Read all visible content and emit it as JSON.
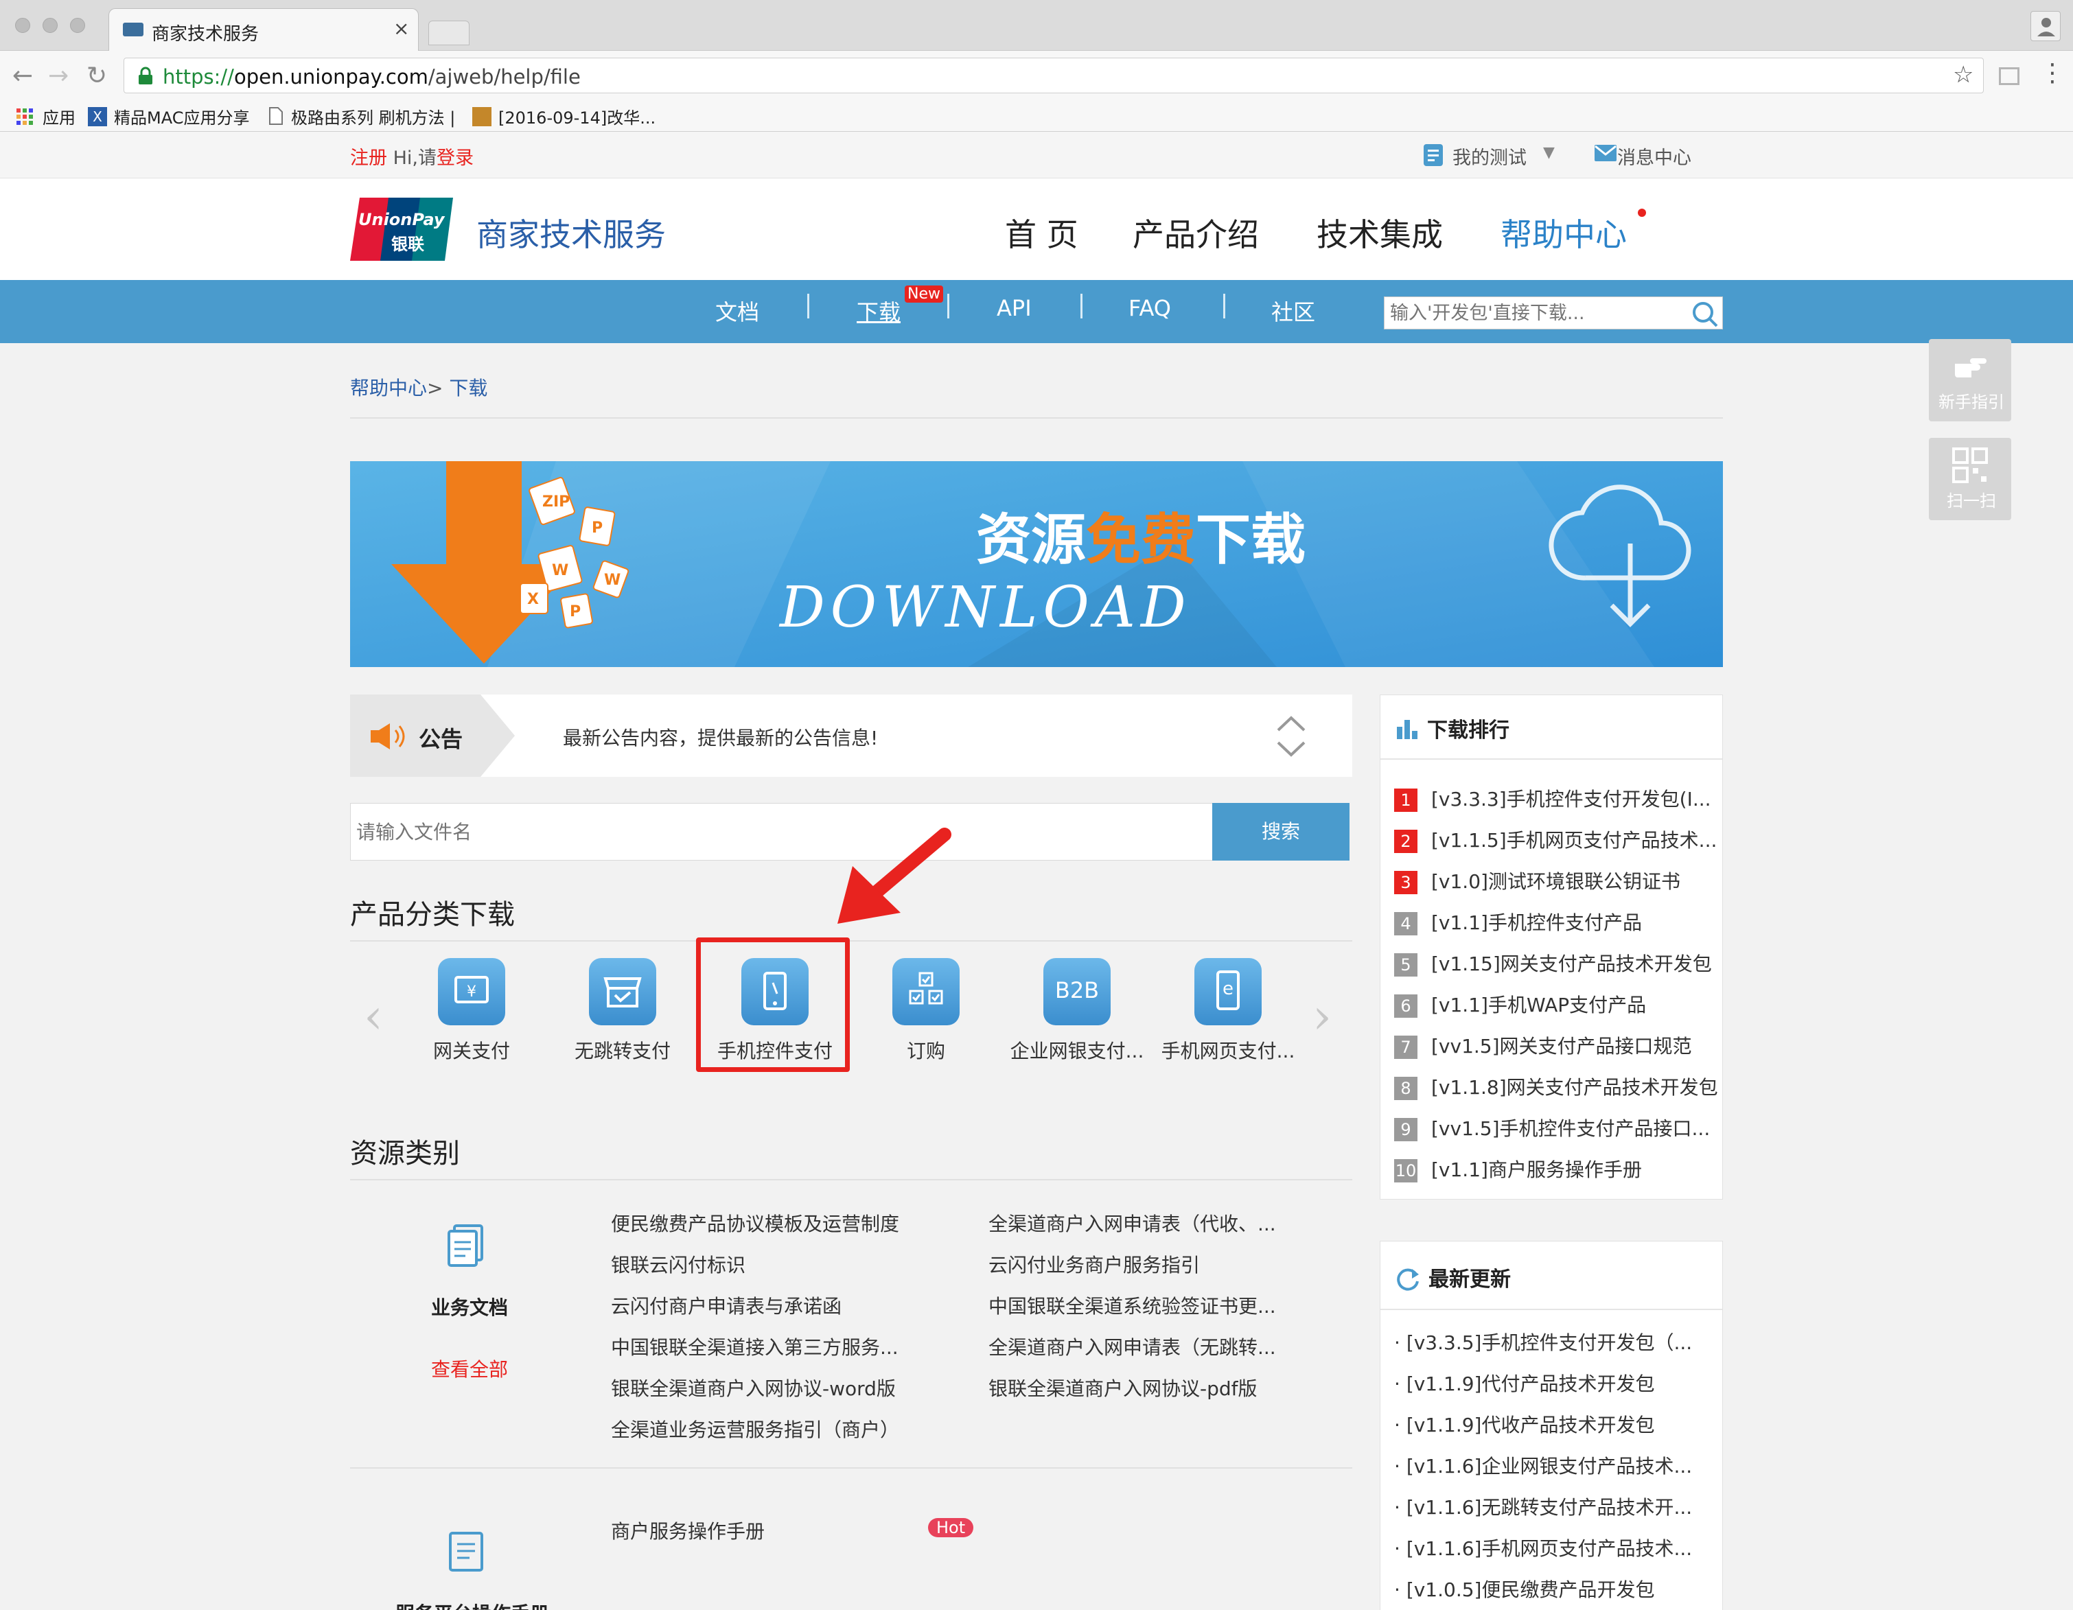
{
  "browser": {
    "tab_title": "商家技术服务",
    "url_secure": "https://",
    "url_host": "open.unionpay.com",
    "url_path": "/ajweb/help/file",
    "bookmarks": [
      "应用",
      "精品MAC应用分享",
      "极路由系列 刷机方法 |",
      "[2016-09-14]改华..."
    ]
  },
  "topbar": {
    "register": "注册",
    "greeting": "Hi,请",
    "login": "登录",
    "my_test": "我的测试",
    "messages": "消息中心"
  },
  "header": {
    "logo_text_en": "UnionPay",
    "logo_text_cn": "银联",
    "site_title": "商家技术服务",
    "nav": [
      "首 页",
      "产品介绍",
      "技术集成",
      "帮助中心"
    ]
  },
  "subnav": {
    "items": [
      "文档",
      "下载",
      "API",
      "FAQ",
      "社区"
    ],
    "new_badge": "New",
    "search_placeholder": "输入'开发包'直接下载..."
  },
  "float_buttons": [
    "新手指引",
    "扫一扫"
  ],
  "breadcrumb": {
    "root": "帮助中心",
    "sep": ">",
    "current": "下载"
  },
  "banner": {
    "title_a": "资源",
    "title_b": "免费",
    "title_c": "下载",
    "subtitle": "DOWNLOAD",
    "file_tags": [
      "ZIP",
      "P",
      "W",
      "W",
      "X",
      "P"
    ]
  },
  "notice": {
    "label": "公告",
    "text": "最新公告内容，提供最新的公告信息!"
  },
  "file_search": {
    "placeholder": "请输入文件名",
    "button": "搜索"
  },
  "products": {
    "title": "产品分类下载",
    "items": [
      {
        "label": "网关支付",
        "icon": "gateway-pay-icon"
      },
      {
        "label": "无跳转支付",
        "icon": "store-pay-icon"
      },
      {
        "label": "手机控件支付",
        "icon": "mobile-control-icon"
      },
      {
        "label": "订购",
        "icon": "order-icon"
      },
      {
        "label": "企业网银支付...",
        "icon": "b2b-icon",
        "icon_text": "B2B"
      },
      {
        "label": "手机网页支付...",
        "icon": "mobile-web-icon",
        "icon_text": "e"
      }
    ],
    "highlight_color": "#e8231f"
  },
  "resources": {
    "title": "资源类别",
    "group1": {
      "name": "业务文档",
      "view_all": "查看全部",
      "col1": [
        "便民缴费产品协议模板及运营制度",
        "银联云闪付标识",
        "云闪付商户申请表与承诺函",
        "中国银联全渠道接入第三方服务...",
        "银联全渠道商户入网协议-word版",
        "全渠道业务运营服务指引（商户）"
      ],
      "col2": [
        "全渠道商户入网申请表（代收、...",
        "云闪付业务商户服务指引",
        "中国银联全渠道系统验签证书更...",
        "全渠道商户入网申请表（无跳转...",
        "银联全渠道商户入网协议-pdf版"
      ]
    },
    "group2": {
      "name": "服务平台操作手册",
      "item": "商户服务操作手册",
      "badge": "Hot"
    }
  },
  "ranking": {
    "title": "下载排行",
    "items": [
      {
        "num": "1",
        "text": "[v3.3.3]手机控件支付开发包(I..."
      },
      {
        "num": "2",
        "text": "[v1.1.5]手机网页支付产品技术..."
      },
      {
        "num": "3",
        "text": "[v1.0]测试环境银联公钥证书"
      },
      {
        "num": "4",
        "text": "[v1.1]手机控件支付产品"
      },
      {
        "num": "5",
        "text": "[v1.15]网关支付产品技术开发包"
      },
      {
        "num": "6",
        "text": "[v1.1]手机WAP支付产品"
      },
      {
        "num": "7",
        "text": "[vv1.5]网关支付产品接口规范"
      },
      {
        "num": "8",
        "text": "[v1.1.8]网关支付产品技术开发包"
      },
      {
        "num": "9",
        "text": "[vv1.5]手机控件支付产品接口..."
      },
      {
        "num": "10",
        "text": "[v1.1]商户服务操作手册"
      }
    ],
    "colors": {
      "top": "#e8231f",
      "rest": "#9a9a9a"
    }
  },
  "updates": {
    "title": "最新更新",
    "items": [
      "[v3.3.5]手机控件支付开发包（...",
      "[v1.1.9]代付产品技术开发包",
      "[v1.1.9]代收产品技术开发包",
      "[v1.1.6]企业网银支付产品技术...",
      "[v1.1.6]无跳转支付产品技术开...",
      "[v1.1.6]手机网页支付产品技术...",
      "[v1.0.5]便民缴费产品开发包"
    ]
  },
  "colors": {
    "accent": "#4a9bcd",
    "red": "#e8231f",
    "orange": "#f07d1a",
    "link": "#2b82c8"
  }
}
